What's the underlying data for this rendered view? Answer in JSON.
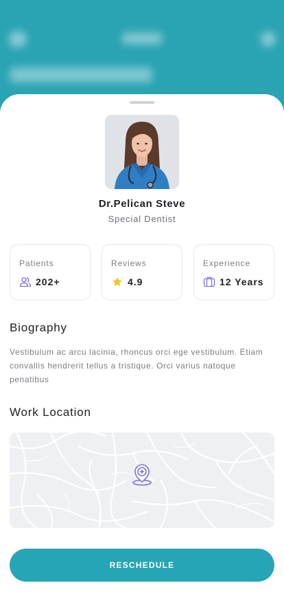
{
  "doctor": {
    "name": "Dr.Pelican Steve",
    "specialty": "Special Dentist"
  },
  "stats": [
    {
      "label": "Patients",
      "value": "202+",
      "icon": "people-icon"
    },
    {
      "label": "Reviews",
      "value": "4.9",
      "icon": "star-icon"
    },
    {
      "label": "Experience",
      "value": "12 Years",
      "icon": "briefcase-icon"
    }
  ],
  "biography": {
    "title": "Biography",
    "text": "Vestibulum ac arcu lacinia, rhoncus orci ege vestibulum. Etiam convallis hendrerit tellus a tristique. Orci varius natoque penatibus"
  },
  "location": {
    "title": "Work Location",
    "pin_icon": "clinic-location-pin-icon"
  },
  "actions": {
    "reschedule_label": "RESCHEDULE"
  },
  "colors": {
    "accent": "#26a5b6",
    "header_bg": "#2aa3b3",
    "icon_purple": "#7c6fd6",
    "star": "#f5c518"
  }
}
